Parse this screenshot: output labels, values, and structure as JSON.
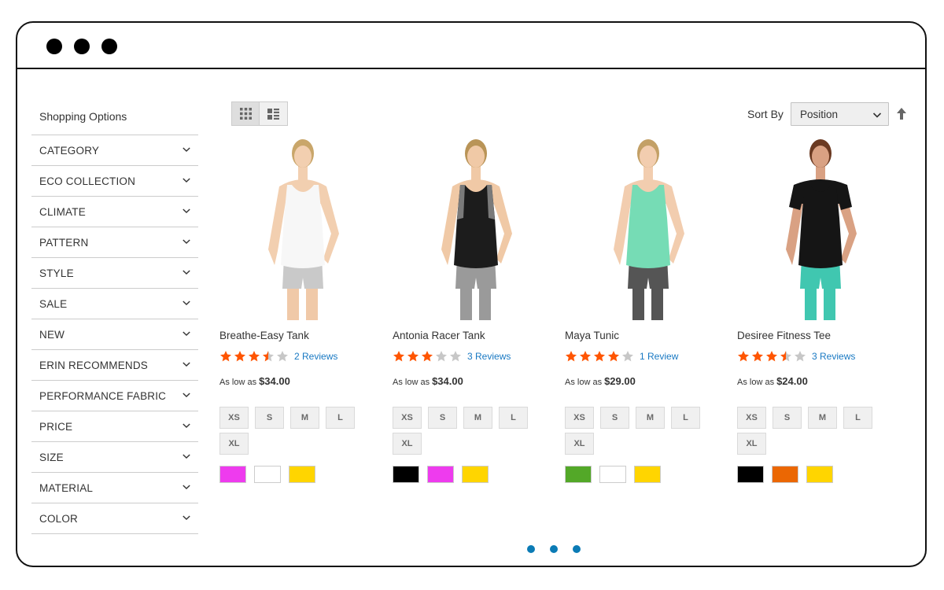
{
  "sidebar": {
    "title": "Shopping Options",
    "filters": [
      "CATEGORY",
      "ECO COLLECTION",
      "CLIMATE",
      "PATTERN",
      "STYLE",
      "SALE",
      "NEW",
      "ERIN RECOMMENDS",
      "PERFORMANCE FABRIC",
      "PRICE",
      "SIZE",
      "MATERIAL",
      "COLOR"
    ]
  },
  "toolbar": {
    "view_modes": [
      {
        "icon": "grid-view-icon",
        "active": true
      },
      {
        "icon": "list-view-icon",
        "active": false
      }
    ],
    "sort_label": "Sort By",
    "sort_value": "Position",
    "sort_direction_icon": "sort-ascending-arrow-icon"
  },
  "products": [
    {
      "name": "Breathe-Easy Tank",
      "rating": 3.5,
      "reviews": "2  Reviews",
      "price_prefix": "As low as",
      "price": "$34.00",
      "sizes": [
        "XS",
        "S",
        "M",
        "L",
        "XL"
      ],
      "colors": [
        "#ee3bee",
        "#ffffff",
        "#ffd500"
      ],
      "figure": {
        "skin": "#f2cfb0",
        "hair": "#c9a66a",
        "top": "#f7f7f7",
        "bottom": "#c9c9c9",
        "legs": "#f0c9a8",
        "sleeves": false,
        "panels": null
      }
    },
    {
      "name": "Antonia Racer Tank",
      "rating": 3,
      "reviews": "3  Reviews",
      "price_prefix": "As low as",
      "price": "$34.00",
      "sizes": [
        "XS",
        "S",
        "M",
        "L",
        "XL"
      ],
      "colors": [
        "#000000",
        "#ee3bee",
        "#ffd500"
      ],
      "figure": {
        "skin": "#f0c9a6",
        "hair": "#b99457",
        "top": "#1c1c1c",
        "bottom": "#9a9a9a",
        "legs": "#9a9a9a",
        "sleeves": false,
        "panels": "#7a7a7a"
      }
    },
    {
      "name": "Maya Tunic",
      "rating": 4,
      "reviews": "1  Review",
      "price_prefix": "As low as",
      "price": "$29.00",
      "sizes": [
        "XS",
        "S",
        "M",
        "L",
        "XL"
      ],
      "colors": [
        "#53a828",
        "#ffffff",
        "#ffd500"
      ],
      "figure": {
        "skin": "#f2cdaf",
        "hair": "#c3a066",
        "top": "#76dcb5",
        "bottom": "#555555",
        "legs": "#555555",
        "sleeves": false,
        "panels": null
      }
    },
    {
      "name": "Desiree Fitness Tee",
      "rating": 3.5,
      "reviews": "3  Reviews",
      "price_prefix": "As low as",
      "price": "$24.00",
      "sizes": [
        "XS",
        "S",
        "M",
        "L",
        "XL"
      ],
      "colors": [
        "#000000",
        "#eb6703",
        "#ffd500"
      ],
      "figure": {
        "skin": "#d9a183",
        "hair": "#6b3a22",
        "top": "#151515",
        "bottom": "#40c7b0",
        "legs": "#40c7b0",
        "sleeves": true,
        "panels": null
      }
    }
  ],
  "pager": {
    "count": 3
  }
}
